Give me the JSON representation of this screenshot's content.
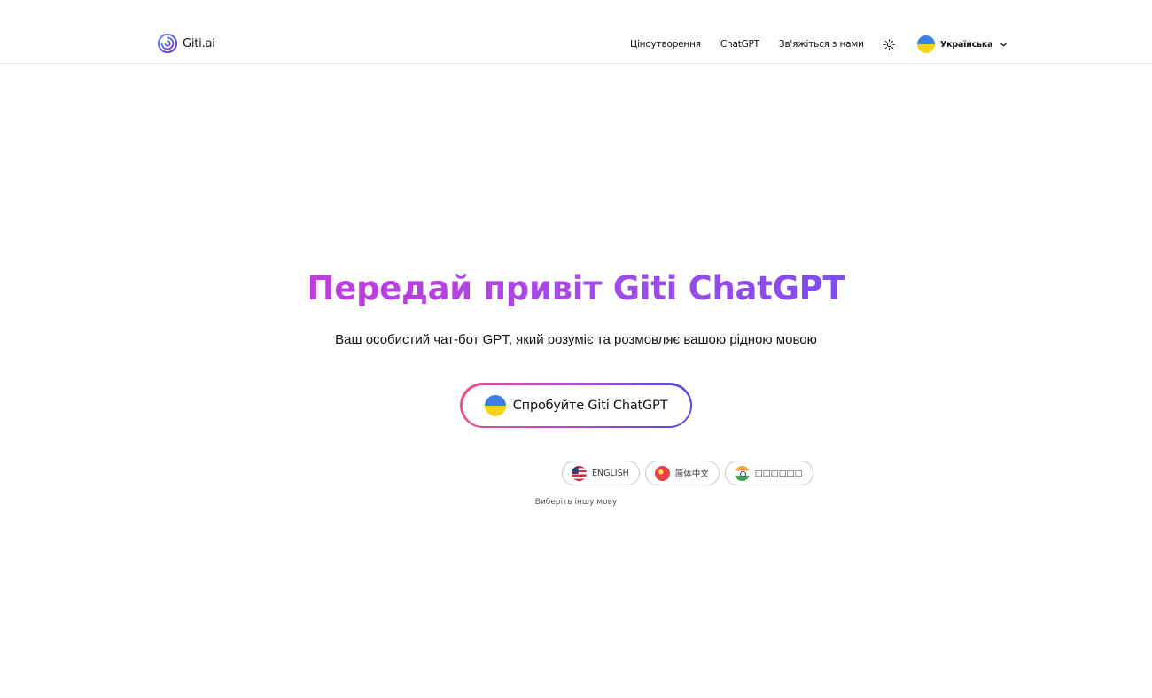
{
  "header": {
    "logo_text": "Giti.ai",
    "nav": [
      {
        "label": "Ціноутворення"
      },
      {
        "label": "ChatGPT"
      },
      {
        "label": "Зв'яжіться з нами"
      }
    ],
    "theme_icon": "sun-icon",
    "language": {
      "selected": "Українська",
      "flag": "ukraine-flag-icon"
    }
  },
  "hero": {
    "title": "Передай привіт Giti ChatGPT",
    "subtitle": "Ваш особистий чат-бот GPT, який розуміє та розмовляє вашою рідною мовою",
    "cta_label": "Спробуйте Giti ChatGPT"
  },
  "languages": {
    "chips": [
      {
        "label": "ENGLISH",
        "flag": "us-flag-icon"
      },
      {
        "label": "简体中文",
        "flag": "china-flag-icon"
      },
      {
        "label": "□□□□□□",
        "flag": "india-flag-icon"
      }
    ],
    "other_link": "Виберіть іншу мову"
  },
  "colors": {
    "title_gradient_start": "#c23be0",
    "title_gradient_end": "#7f4df0",
    "cta_border_start": "#f04f86",
    "cta_border_end": "#4e49e6"
  }
}
